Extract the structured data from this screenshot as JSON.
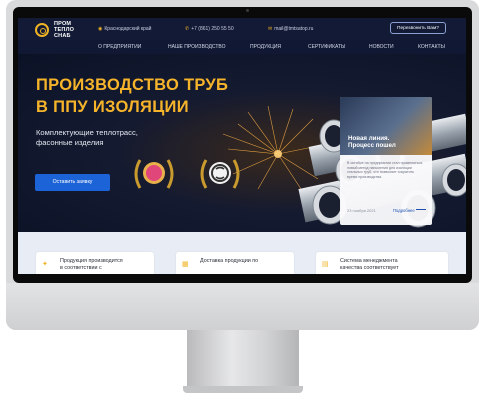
{
  "logo": {
    "line1": "ПРОМ",
    "line2": "ТЕПЛО",
    "line3": "СНАБ"
  },
  "header": {
    "region": "Краснодарский край",
    "phone": "+7 (861) 250 55 50",
    "email": "mail@tmtsatop.ru",
    "call_button": "Перезвонить Вам?"
  },
  "nav": {
    "items": [
      "О ПРЕДПРИЯТИИ",
      "НАШЕ ПРОИЗВОДСТВО",
      "ПРОДУКЦИЯ",
      "СЕРТИФИКАТЫ",
      "НОВОСТИ",
      "КОНТАКТЫ"
    ]
  },
  "hero": {
    "title_line1": "ПРОИЗВОДСТВО ТРУБ",
    "title_line2": "В ППУ ИЗОЛЯЦИИ",
    "subtitle_line1": "Комплектующие теплотрасс,",
    "subtitle_line2": "фасонные изделия",
    "cta": "Оставить заявку"
  },
  "news_card": {
    "title_line1": "Новая линия.",
    "title_line2": "Процесс пошел",
    "text": "В октябре на предприятии стал применяться новый метод напыления для изоляции стальных труб, что позволяет сократить время производства.",
    "date": "23 ноября 2021",
    "link": "Подробнее"
  },
  "features": [
    {
      "text_line1": "Продукция производится",
      "text_line2": "в соответствии с"
    },
    {
      "text_line1": "Доставка продукции по",
      "text_line2": ""
    },
    {
      "text_line1": "Система менеджмента",
      "text_line2": "качества соответствует"
    }
  ],
  "colors": {
    "accent": "#f0b323",
    "brand_blue": "#1d63d8",
    "header_bg": "#121a36"
  },
  "icons": {
    "region": "location-icon",
    "phone": "phone-icon",
    "email": "mail-icon"
  }
}
